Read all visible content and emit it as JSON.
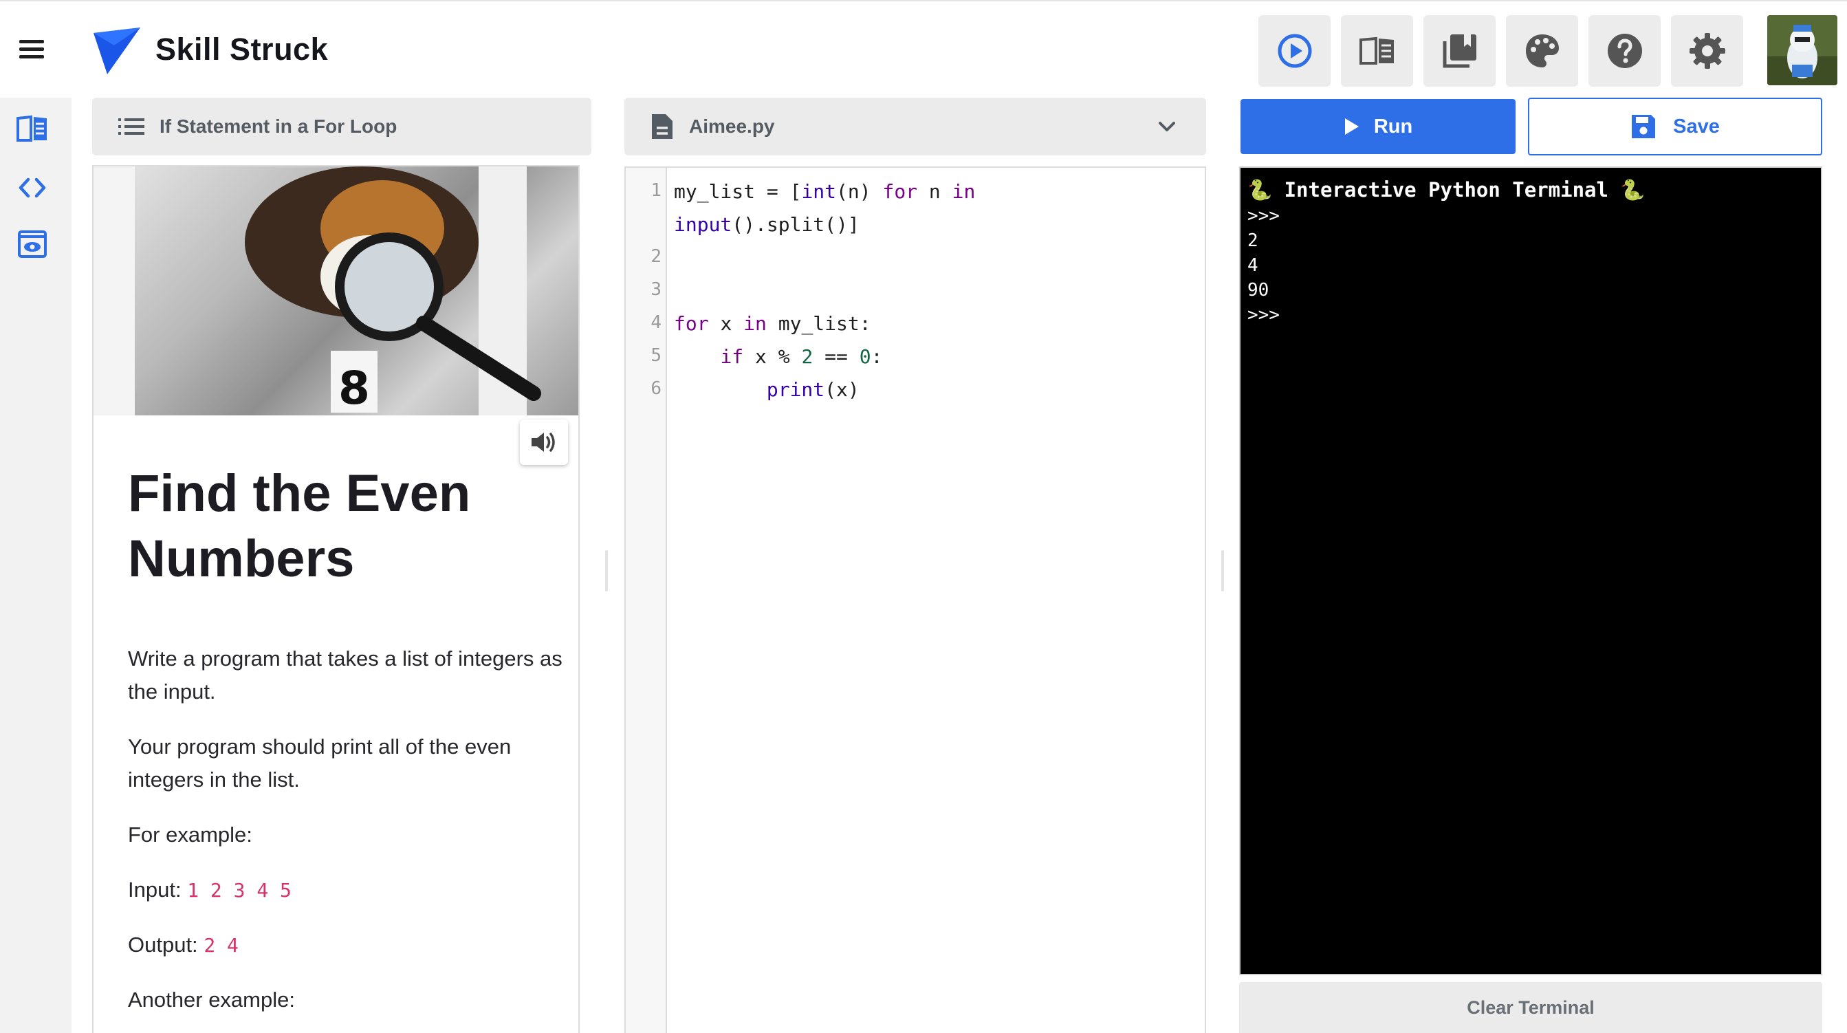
{
  "app": {
    "brand": "Skill Struck",
    "accent_color": "#2e6ee6"
  },
  "toolbar": {
    "buttons": [
      {
        "name": "run-preview-button",
        "icon": "play-circle-icon"
      },
      {
        "name": "lessons-button",
        "icon": "open-book-icon"
      },
      {
        "name": "library-button",
        "icon": "library-books-icon"
      },
      {
        "name": "theme-button",
        "icon": "palette-icon"
      },
      {
        "name": "help-button",
        "icon": "help-circle-icon"
      },
      {
        "name": "settings-button",
        "icon": "gear-icon"
      }
    ],
    "avatar": "user-avatar"
  },
  "sidebar": {
    "items": [
      {
        "name": "lesson-view",
        "icon": "book-icon"
      },
      {
        "name": "code-view",
        "icon": "code-brackets-icon"
      },
      {
        "name": "preview-view",
        "icon": "eye-window-icon"
      }
    ]
  },
  "lesson": {
    "header": "If Statement in a For Loop",
    "title": "Find the Even Numbers",
    "paragraphs": [
      "Write a program that takes a list of integers as the input.",
      "Your program should print all of the even integers in the list.",
      "For example:"
    ],
    "example_input_label": "Input:",
    "example_input_value": "1 2 3 4 5",
    "example_output_label": "Output:",
    "example_output_value": "2 4",
    "another_example": "Another example:"
  },
  "editor": {
    "filename": "Aimee.py",
    "line_numbers": [
      "1",
      "2",
      "3",
      "4",
      "5",
      "6"
    ],
    "lines": [
      "my_list = [int(n) for n in input().split()]",
      "",
      "",
      "for x in my_list:",
      "    if x % 2 == 0:",
      "        print(x)"
    ]
  },
  "actions": {
    "run_label": "Run",
    "save_label": "Save"
  },
  "terminal": {
    "title": "🐍 Interactive Python Terminal 🐍",
    "output": [
      ">>>",
      "2",
      "4",
      "90",
      ">>>"
    ],
    "clear_label": "Clear Terminal"
  }
}
